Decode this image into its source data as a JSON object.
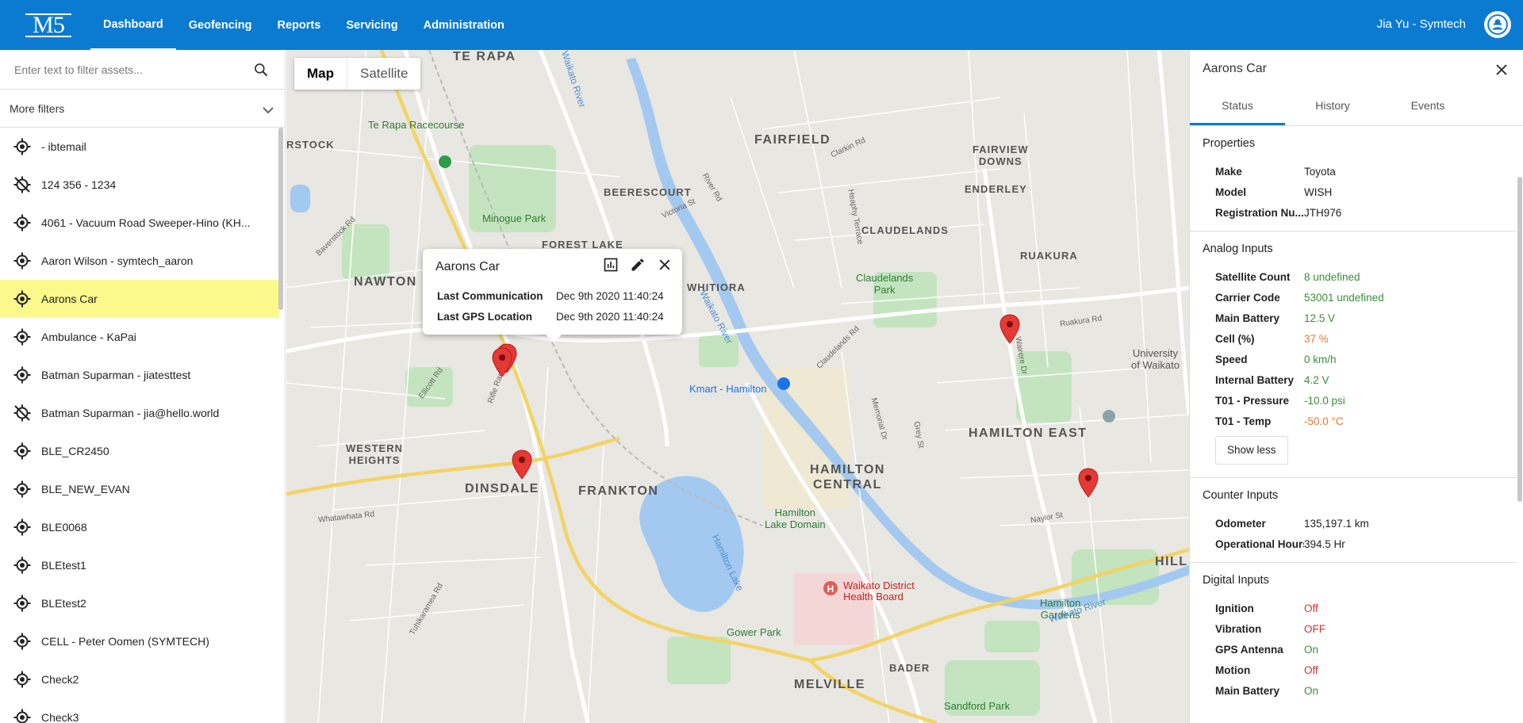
{
  "app": {
    "logo": "M5",
    "nav": [
      "Dashboard",
      "Geofencing",
      "Reports",
      "Servicing",
      "Administration"
    ],
    "user": "Jia Yu - Symtech"
  },
  "sidebar": {
    "filter_placeholder": "Enter text to filter assets...",
    "more_filters": "More filters",
    "assets": [
      {
        "name": "- ibtemail",
        "icon": "gps-fixed-icon"
      },
      {
        "name": "124 356 - 1234",
        "icon": "gps-off-icon"
      },
      {
        "name": "4061 - Vacuum Road Sweeper-Hino (KH...",
        "icon": "gps-fixed-icon"
      },
      {
        "name": "Aaron Wilson - symtech_aaron",
        "icon": "gps-fixed-icon"
      },
      {
        "name": "Aarons Car",
        "icon": "gps-fixed-icon",
        "selected": true
      },
      {
        "name": "Ambulance - KaPai",
        "icon": "gps-fixed-icon"
      },
      {
        "name": "Batman Suparman - jiatesttest",
        "icon": "gps-fixed-icon"
      },
      {
        "name": "Batman Suparman - jia@hello.world",
        "icon": "gps-off-icon"
      },
      {
        "name": "BLE_CR2450",
        "icon": "gps-fixed-icon"
      },
      {
        "name": "BLE_NEW_EVAN",
        "icon": "gps-fixed-icon"
      },
      {
        "name": "BLE0068",
        "icon": "gps-fixed-icon"
      },
      {
        "name": "BLEtest1",
        "icon": "gps-fixed-icon"
      },
      {
        "name": "BLEtest2",
        "icon": "gps-fixed-icon"
      },
      {
        "name": "CELL - Peter Oomen (SYMTECH)",
        "icon": "gps-fixed-icon"
      },
      {
        "name": "Check2",
        "icon": "gps-fixed-icon"
      },
      {
        "name": "Check3",
        "icon": "gps-fixed-icon"
      }
    ]
  },
  "map": {
    "types": [
      "Map",
      "Satellite"
    ],
    "labels": {
      "te_rapa": "TE RAPA",
      "fairfield": "FAIRFIELD",
      "fairview_downs": "FAIRVIEW\nDOWNS",
      "enderley": "ENDERLEY",
      "beerescourt": "BEERESCOURT",
      "claudelands": "CLAUDELANDS",
      "forest_lake": "FOREST LAKE",
      "nawton": "NAWTON",
      "whitiora": "WHITIORA",
      "ruakura": "RUAKURA",
      "western_heights": "WESTERN\nHEIGHTS",
      "dinsdale": "DINSDALE",
      "frankton": "FRANKTON",
      "hamilton_central": "HAMILTON\nCENTRAL",
      "hamilton_east": "HAMILTON EAST",
      "hill": "HILL",
      "bader": "BADER",
      "melville": "MELVILLE",
      "rstock": "RSTOCK",
      "te_rapa_racecourse": "Te Rapa Racecourse",
      "minogue_park": "Minogue Park",
      "claudelands_park": "Claudelands\nPark",
      "kmart": "Kmart - Hamilton",
      "hamilton_lake_domain": "Hamilton\nLake Domain",
      "waikato_dhb": "Waikato District\nHealth Board",
      "gower_park": "Gower Park",
      "hamilton_gardens": "Hamilton\nGardens",
      "sandford_park": "Sandford Park",
      "university": "University\nof Waikato",
      "waikato_river": "Waikato River",
      "hamilton_lake": "Hamilton Lake",
      "whatawhata_rd": "Whatawhata Rd",
      "ruakura_rd": "Ruakura Rd",
      "wairere_dr": "Wairere Dr",
      "clarkin_rd": "Clarkin Rd",
      "victoria_st": "Victoria St",
      "river_rd": "River Rd",
      "grey_st": "Grey St",
      "naylor_st": "Naylor St",
      "rifle_range_rd": "Rifle Range Rd",
      "ellicott_rd": "Ellicott Rd",
      "tuhikaramea_rd": "Tuhikaramea Rd",
      "memorial_dr": "Memorial Dr",
      "claudelands_rd": "Claudelands Rd",
      "heaphy_terrace": "Heaphy Terrace",
      "baverstock_rd": "Baverstock Rd"
    }
  },
  "popup": {
    "title": "Aarons Car",
    "rows": [
      {
        "label": "Last Communication",
        "value": "Dec 9th 2020 11:40:24"
      },
      {
        "label": "Last GPS Location",
        "value": "Dec 9th 2020 11:40:24"
      }
    ]
  },
  "panel": {
    "title": "Aarons Car",
    "tabs": [
      "Status",
      "History",
      "Events"
    ],
    "properties": {
      "heading": "Properties",
      "rows": [
        {
          "label": "Make",
          "value": "Toyota"
        },
        {
          "label": "Model",
          "value": "WISH"
        },
        {
          "label": "Registration Nu...",
          "value": "JTH976"
        }
      ]
    },
    "analog": {
      "heading": "Analog Inputs",
      "rows": [
        {
          "label": "Satellite Count",
          "value": "8 undefined",
          "color": "green"
        },
        {
          "label": "Carrier Code",
          "value": "53001 undefined",
          "color": "green"
        },
        {
          "label": "Main Battery",
          "value": "12.5 V",
          "color": "green"
        },
        {
          "label": "Cell (%)",
          "value": "37 %",
          "color": "orange"
        },
        {
          "label": "Speed",
          "value": "0 km/h",
          "color": "green"
        },
        {
          "label": "Internal Battery",
          "value": "4.2 V",
          "color": "green"
        },
        {
          "label": "T01 - Pressure",
          "value": "-10.0 psi",
          "color": "green"
        },
        {
          "label": "T01 - Temp",
          "value": "-50.0 °C",
          "color": "orange"
        }
      ],
      "show_less": "Show less"
    },
    "counter": {
      "heading": "Counter Inputs",
      "rows": [
        {
          "label": "Odometer",
          "value": "135,197.1 km"
        },
        {
          "label": "Operational Hours",
          "value": "394.5 Hr"
        }
      ]
    },
    "digital": {
      "heading": "Digital Inputs",
      "rows": [
        {
          "label": "Ignition",
          "value": "Off",
          "color": "red"
        },
        {
          "label": "Vibration",
          "value": "OFF",
          "color": "red"
        },
        {
          "label": "GPS Antenna",
          "value": "On",
          "color": "green"
        },
        {
          "label": "Motion",
          "value": "Off",
          "color": "red"
        },
        {
          "label": "Main Battery",
          "value": "On",
          "color": "green"
        }
      ]
    }
  },
  "colors": {
    "brand": "#0b7bd1",
    "selected_row": "#fcf98c",
    "pin": "#e53935"
  }
}
